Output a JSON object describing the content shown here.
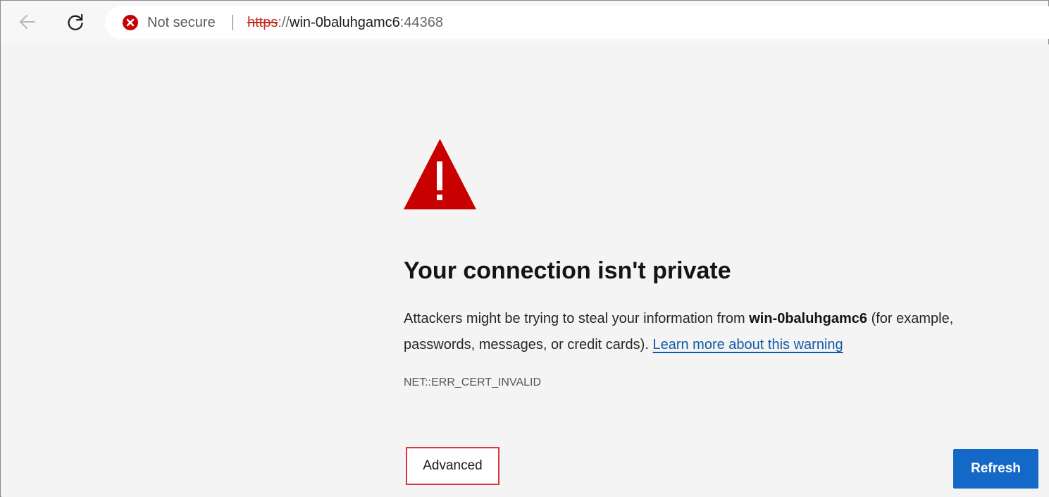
{
  "browser": {
    "back_icon": "arrow-left-icon",
    "reload_icon": "refresh-icon",
    "security_icon": "error-x-circle-icon",
    "security_label": "Not secure",
    "url": {
      "scheme": "https",
      "separator": "://",
      "host": "win-0baluhgamc6",
      "port": ":44368"
    }
  },
  "page": {
    "warning_icon": "warning-triangle-icon",
    "heading": "Your connection isn't private",
    "message": {
      "before": "Attackers might be trying to steal your information from ",
      "host": "win-0baluhgamc6",
      "after": " (for example, passwords, messages, or credit cards). ",
      "link": "Learn more about this warning"
    },
    "error_code": "NET::ERR_CERT_INVALID",
    "advanced_button": "Advanced",
    "refresh_button": "Refresh"
  },
  "colors": {
    "danger": "#c80000",
    "link": "#0f5aa6",
    "primary_button": "#1469c8",
    "highlight_border": "#d9373a"
  }
}
